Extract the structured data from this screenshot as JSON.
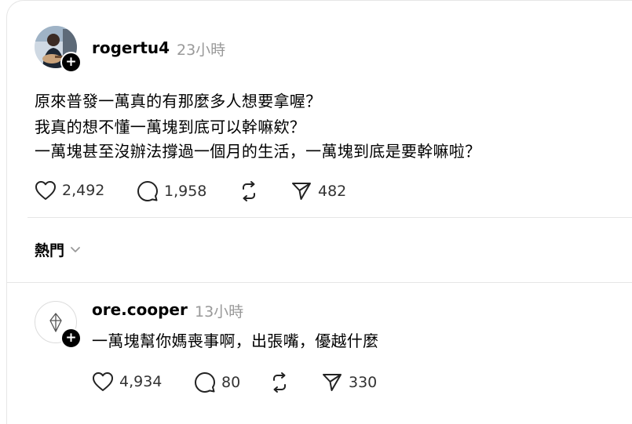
{
  "post": {
    "username": "rogertu4",
    "timestamp": "23小時",
    "lines": [
      "原來普發一萬真的有那麼多人想要拿喔？",
      "我真的想不懂一萬塊到底可以幹嘛欸？",
      "一萬塊甚至沒辦法撐過一個月的生活，一萬塊到底是要幹嘛啦？"
    ],
    "likes": "2,492",
    "comments": "1,958",
    "shares": "482"
  },
  "sort": {
    "label": "熱門"
  },
  "reply": {
    "username": "ore.cooper",
    "timestamp": "13小時",
    "text": "一萬塊幫你媽喪事啊，出張嘴，優越什麼",
    "likes": "4,934",
    "comments": "80",
    "shares": "330"
  },
  "icons": {
    "like": "heart-icon",
    "comment": "comment-bubble-icon",
    "repost": "repost-icon",
    "share": "send-icon",
    "follow": "plus-icon",
    "sort": "chevron-down-icon"
  }
}
